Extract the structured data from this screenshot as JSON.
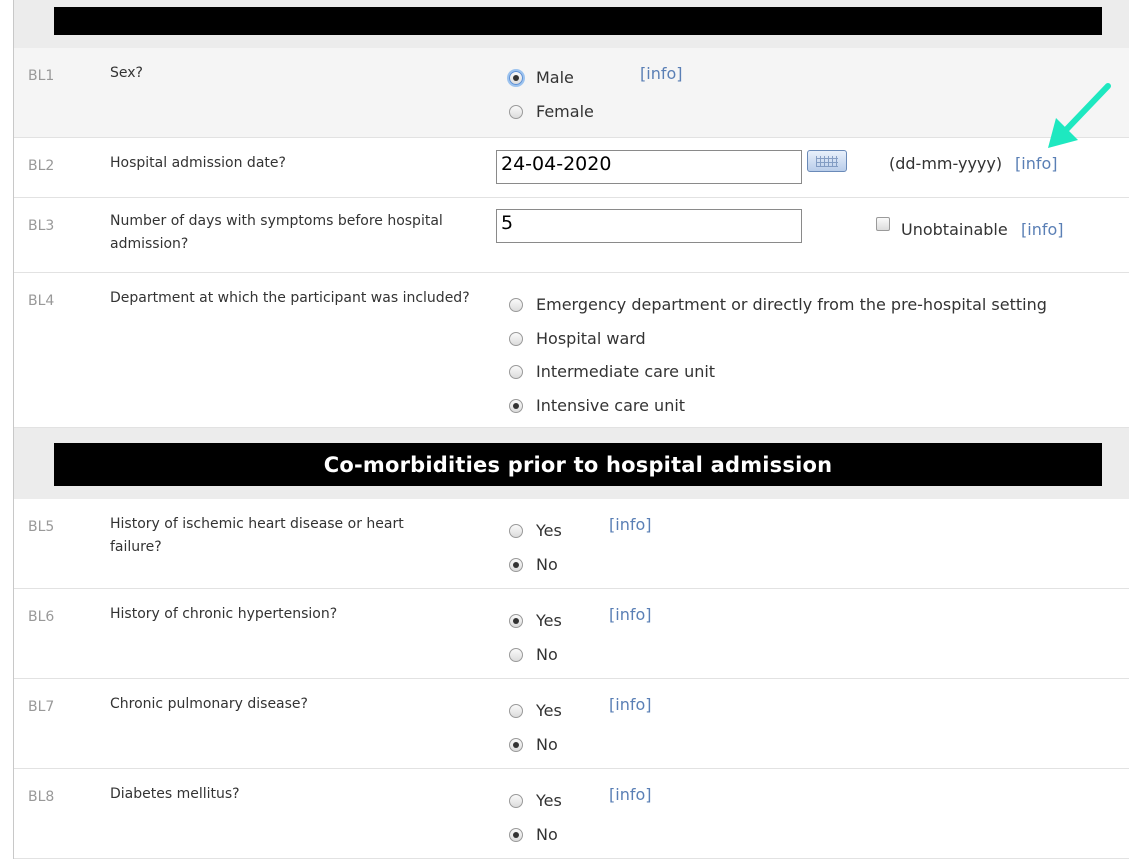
{
  "sections": [
    {
      "title": ""
    },
    {
      "title": "Co-morbidities prior to hospital admission"
    }
  ],
  "info_label": "[info]",
  "questions": {
    "bl1": {
      "code": "BL1",
      "text": "Sex?",
      "options": [
        "Male",
        "Female"
      ],
      "selected": "Male"
    },
    "bl2": {
      "code": "BL2",
      "text": "Hospital admission date?",
      "value": "24-04-2020",
      "format": "(dd-mm-yyyy)"
    },
    "bl3": {
      "code": "BL3",
      "text": "Number of days with symptoms before hospital admission?",
      "value": "5",
      "checkbox_label": "Unobtainable",
      "checked": false
    },
    "bl4": {
      "code": "BL4",
      "text": "Department at which the participant was included?",
      "options": [
        "Emergency department or directly from the pre-hospital setting",
        "Hospital ward",
        "Intermediate care unit",
        "Intensive care unit"
      ],
      "selected": "Intensive care unit"
    },
    "bl5": {
      "code": "BL5",
      "text": "History of ischemic heart disease or heart failure?",
      "options": [
        "Yes",
        "No"
      ],
      "selected": "No"
    },
    "bl6": {
      "code": "BL6",
      "text": "History of chronic hypertension?",
      "options": [
        "Yes",
        "No"
      ],
      "selected": "Yes"
    },
    "bl7": {
      "code": "BL7",
      "text": "Chronic pulmonary disease?",
      "options": [
        "Yes",
        "No"
      ],
      "selected": "No"
    },
    "bl8": {
      "code": "BL8",
      "text": "Diabetes mellitus?",
      "options": [
        "Yes",
        "No"
      ],
      "selected": "No"
    }
  },
  "annotation": {
    "arrow_color": "#1ee8c0"
  }
}
